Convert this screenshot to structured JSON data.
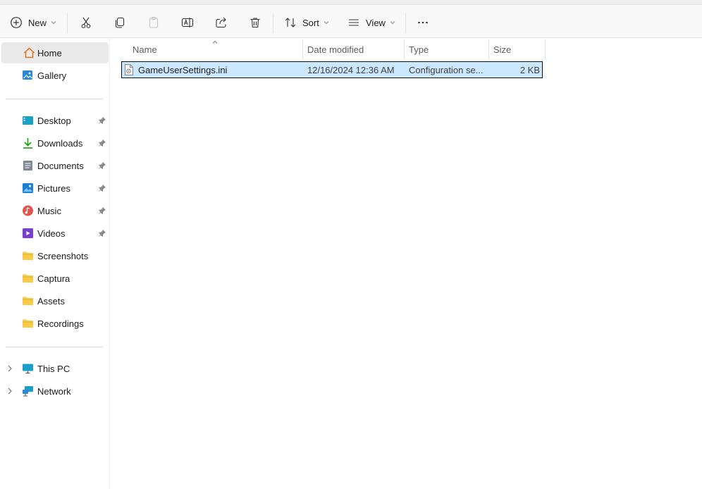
{
  "toolbar": {
    "new_label": "New",
    "sort_label": "Sort",
    "view_label": "View",
    "icons": [
      "plus-circle-icon",
      "cut-icon",
      "copy-icon",
      "paste-icon",
      "rename-icon",
      "share-icon",
      "delete-icon",
      "sort-icon",
      "view-icon",
      "more-icon"
    ]
  },
  "sidebar": {
    "top": [
      {
        "label": "Home",
        "icon": "home-icon",
        "selected": true
      },
      {
        "label": "Gallery",
        "icon": "gallery-icon"
      }
    ],
    "quick_access": [
      {
        "label": "Desktop",
        "icon": "desktop-icon",
        "pinned": true
      },
      {
        "label": "Downloads",
        "icon": "download-icon",
        "pinned": true
      },
      {
        "label": "Documents",
        "icon": "documents-icon",
        "pinned": true
      },
      {
        "label": "Pictures",
        "icon": "pictures-icon",
        "pinned": true
      },
      {
        "label": "Music",
        "icon": "music-icon",
        "pinned": true
      },
      {
        "label": "Videos",
        "icon": "videos-icon",
        "pinned": true
      },
      {
        "label": "Screenshots",
        "icon": "folder-icon"
      },
      {
        "label": "Captura",
        "icon": "folder-icon"
      },
      {
        "label": "Assets",
        "icon": "folder-icon"
      },
      {
        "label": "Recordings",
        "icon": "folder-icon"
      }
    ],
    "locations": [
      {
        "label": "This PC",
        "icon": "pc-icon"
      },
      {
        "label": "Network",
        "icon": "network-icon"
      }
    ]
  },
  "file_list": {
    "columns": [
      "Name",
      "Date modified",
      "Type",
      "Size"
    ],
    "rows": [
      {
        "name": "GameUserSettings.ini",
        "date_modified": "12/16/2024 12:36 AM",
        "type": "Configuration se...",
        "size": "2 KB",
        "selected": true
      }
    ]
  },
  "colors": {
    "selection_bg": "#cce8ff",
    "accent_blue": "#0067c0",
    "folder_yellow": "#f8c94a"
  }
}
